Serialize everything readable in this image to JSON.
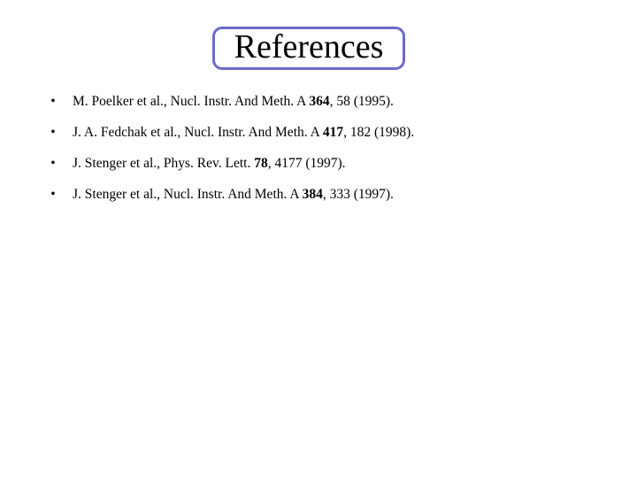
{
  "slide": {
    "background_color": "#ffffff",
    "title": {
      "text": "References",
      "border_color": "#6b6bcb",
      "text_color": "#000000"
    },
    "bullet_glyph": "•",
    "references": [
      {
        "bullet": "•",
        "full_text": "M. Poelker et al., Nucl. Instr. And Meth. A 364, 58 (1995).",
        "authors": "M. Poelker et al.",
        "journal": "Nucl. Instr. And Meth. A",
        "before_volume": "M. Poelker et al., Nucl. Instr. And Meth. A ",
        "volume": "364",
        "after_volume": ", 58 (1995).",
        "page": "58",
        "year": "1995"
      },
      {
        "bullet": "•",
        "full_text": "J. A. Fedchak et al., Nucl. Instr. And Meth. A 417, 182 (1998).",
        "authors": "J. A. Fedchak et al.",
        "journal": "Nucl. Instr. And Meth. A",
        "before_volume": "J. A. Fedchak et al., Nucl. Instr. And Meth. A ",
        "volume": "417",
        "after_volume": ", 182 (1998).",
        "page": "182",
        "year": "1998"
      },
      {
        "bullet": "•",
        "full_text": "J. Stenger et al., Phys. Rev. Lett. 78, 4177 (1997).",
        "authors": "J. Stenger et al.",
        "journal": "Phys. Rev. Lett.",
        "before_volume": "J. Stenger et al., Phys. Rev. Lett. ",
        "volume": "78",
        "after_volume": ", 4177 (1997).",
        "page": "4177",
        "year": "1997"
      },
      {
        "bullet": "•",
        "full_text": "J. Stenger et al., Nucl. Instr. And Meth. A 384, 333 (1997).",
        "authors": "J. Stenger et al.",
        "journal": "Nucl. Instr. And Meth. A",
        "before_volume": "J. Stenger et al., Nucl. Instr. And Meth. A ",
        "volume": "384",
        "after_volume": ", 333 (1997).",
        "page": "333",
        "year": "1997"
      }
    ]
  }
}
